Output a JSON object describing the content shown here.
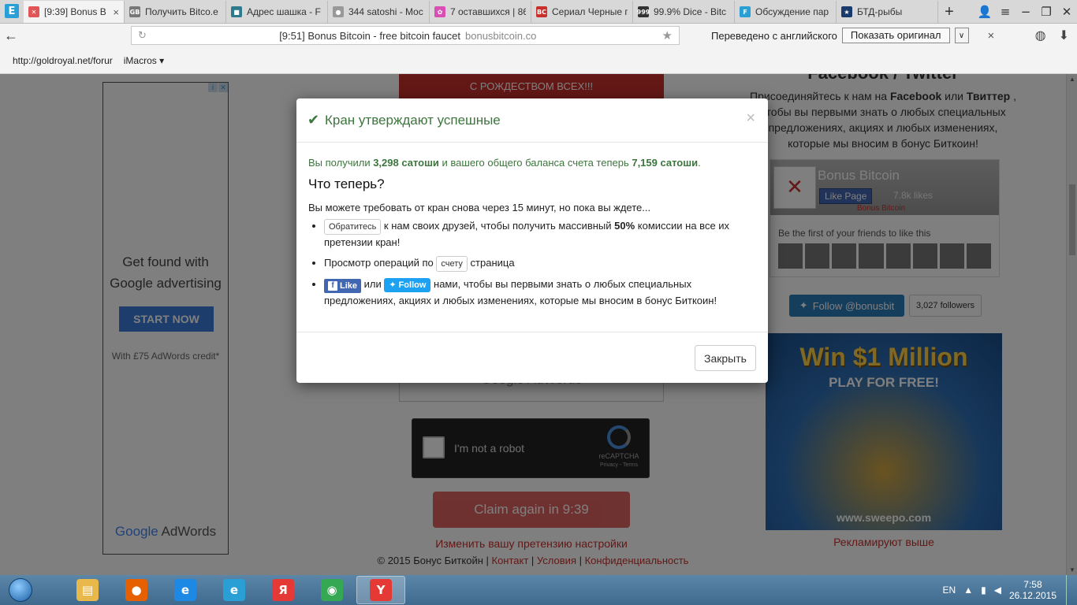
{
  "browser": {
    "tabs": [
      {
        "title": "[9:39] Bonus B",
        "fav_color": "#e05555",
        "fav_glyph": "✕",
        "active": true
      },
      {
        "title": "Получить Bitco.e",
        "fav_color": "#777777",
        "fav_glyph": "GB",
        "active": false
      },
      {
        "title": "Адрес шашка - F",
        "fav_color": "#2c7a8c",
        "fav_glyph": "■",
        "active": false
      },
      {
        "title": "344 satoshi - Moc",
        "fav_color": "#999999",
        "fav_glyph": "●",
        "active": false
      },
      {
        "title": "7 оставшихся | 86",
        "fav_color": "#d94fb3",
        "fav_glyph": "✿",
        "active": false
      },
      {
        "title": "Сериал Черные г",
        "fav_color": "#c9302c",
        "fav_glyph": "BC",
        "active": false
      },
      {
        "title": "99.9% Dice - Bitc",
        "fav_color": "#333333",
        "fav_glyph": "999",
        "active": false
      },
      {
        "title": "Обсуждение пар",
        "fav_color": "#2a9fd6",
        "fav_glyph": "F",
        "active": false
      },
      {
        "title": "БТД-рыбы",
        "fav_color": "#1a3a6b",
        "fav_glyph": "★",
        "active": false
      }
    ],
    "logo_glyph": "E",
    "new_tab_glyph": "+",
    "tab_close_glyph": "×",
    "address": {
      "title": "[9:51] Bonus Bitcoin - free bitcoin faucet",
      "domain": "bonusbitcoin.co"
    },
    "translate": {
      "label": "Переведено с английского",
      "show_original": "Показать оригинал",
      "dropdown_glyph": "∨",
      "close_glyph": "×"
    },
    "bookmarks": [
      "http://goldroyal.net/forur",
      "iMacros ▾"
    ]
  },
  "page": {
    "left_ad": {
      "headline": "Get found with Google advertising",
      "cta": "START NOW",
      "credit": "With £75 AdWords credit*",
      "brand_google": "Google",
      "brand_adwords": " AdWords"
    },
    "banner": "С РОЖДЕСТВОМ ВСЕХ!!!",
    "center_box_text": "Google AdWords",
    "recaptcha": {
      "label": "I'm not a robot",
      "brand": "reCAPTCHA",
      "links": "Privacy - Terms"
    },
    "claim_button": "Claim again in 9:39",
    "change_link": "Изменить вашу претензию настройки",
    "footer": {
      "copyright": "© 2015 Бонус Биткойн | ",
      "contact": "Контакт",
      "sep1": " | ",
      "terms": "Условия",
      "sep2": " | ",
      "privacy": "Конфиденциальность"
    },
    "right": {
      "heading": "Facebook / Twitter",
      "join_text_1": "Присоединяйтесь к нам на ",
      "join_facebook": "Facebook",
      "join_or": " или ",
      "join_twitter": "Твиттер",
      "join_text_2": " , чтобы вы первыми знать о любых специальных предложениях, акциях и любых изменениях, которые мы вносим в бонус Биткоин!",
      "fb_name": "Bonus Bitcoin",
      "fb_like": "Like Page",
      "fb_likes": "7.8k likes",
      "fb_sub": "Bonus Bitcoin",
      "fb_first": "Be the first of your friends to like this",
      "tw_follow": "Follow @bonusbit",
      "tw_count": "3,027 followers",
      "prize_big": "Win $1 Million",
      "prize_free": "PLAY FOR FREE!",
      "prize_url": "www.sweepo.com",
      "ad_label": "Рекламируют выше"
    }
  },
  "modal": {
    "title": "Кран утверждают успешные",
    "close_glyph": "×",
    "success_pre": "Вы получили ",
    "amount": "3,298 сатоши",
    "success_mid": " и вашего общего баланса счета теперь ",
    "balance": "7,159 сатоши",
    "success_end": ".",
    "what_now": "Что теперь?",
    "wait_line": "Вы можете требовать от кран снова через 15 минут, но пока вы ждете...",
    "item1_btn": "Обратитесь",
    "item1_text_a": " к нам своих друзей, чтобы получить массивный ",
    "item1_pct": "50%",
    "item1_text_b": " комиссии на все их претензии кран!",
    "item2_text_a": "Просмотр операций по ",
    "item2_btn": "счету",
    "item2_text_b": " страница",
    "item3_fb": "Like",
    "item3_or": " или ",
    "item3_tw": "Follow",
    "item3_text": " нами, чтобы вы первыми знать о любых специальных предложениях, акциях и любых изменениях, которые мы вносим в бонус Биткоин!",
    "close_button": "Закрыть"
  },
  "taskbar": {
    "apps": [
      {
        "name": "explorer",
        "color": "#e8b84a",
        "glyph": "▤"
      },
      {
        "name": "firefox",
        "color": "#e66000",
        "glyph": "●"
      },
      {
        "name": "ie",
        "color": "#1e88e5",
        "glyph": "e"
      },
      {
        "name": "edge",
        "color": "#2a9fd6",
        "glyph": "e"
      },
      {
        "name": "yandex",
        "color": "#e53935",
        "glyph": "Я"
      },
      {
        "name": "chrome",
        "color": "#34a853",
        "glyph": "◉"
      },
      {
        "name": "yandex-browser",
        "color": "#e53935",
        "glyph": "Y",
        "active": true
      }
    ],
    "lang": "EN",
    "time": "7:58",
    "date": "26.12.2015"
  }
}
